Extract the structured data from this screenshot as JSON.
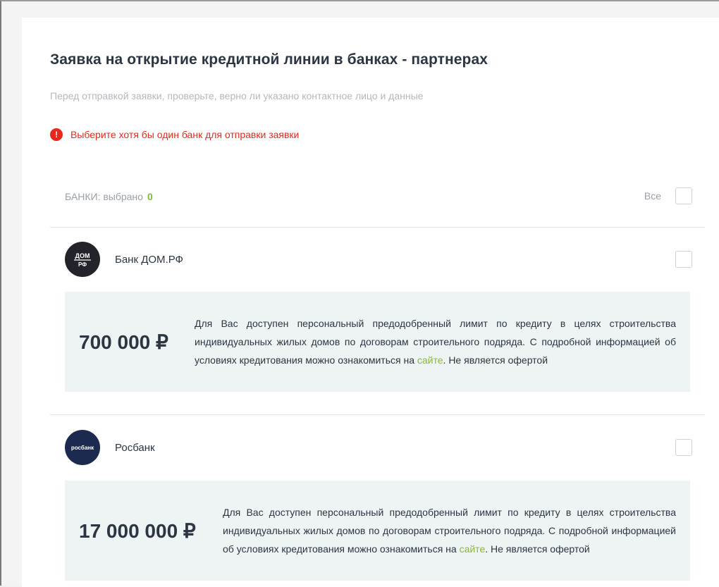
{
  "header": {
    "title": "Заявка на открытие кредитной линии в банках - партнерах",
    "subtitle": "Перед отправкой заявки, проверьте, верно ли указано контактное лицо и данные"
  },
  "error": {
    "icon": "exclamation-icon",
    "text": "Выберите хотя бы один банк для отправки заявки"
  },
  "banks_header": {
    "label": "БАНКИ: выбрано",
    "count": "0",
    "all_label": "Все"
  },
  "banks": [
    {
      "name": "Банк ДОМ.РФ",
      "logo_text": "ДОМ",
      "logo_subtext": "РФ",
      "amount": "700 000 ₽",
      "desc_before_link": "Для Вас доступен персональный предодобренный лимит по кредиту в целях строительства индивидуальных жилых домов по договорам строительного подряда. С подробной информацией об условиях кредитования можно ознакомиться на ",
      "link_text": "сайте",
      "desc_after_link": ". Не является офертой"
    },
    {
      "name": "Росбанк",
      "logo_text": "росбанк",
      "amount": "17 000 000 ₽",
      "desc_before_link": "Для Вас доступен персональный предодобренный лимит по кредиту в целях строительства индивидуальных жилых домов по договорам строительного подряда. С подробной информацией об условиях кредитования можно ознакомиться на ",
      "link_text": "сайте",
      "desc_after_link": ". Не является офертой"
    }
  ],
  "colors": {
    "error": "#e8271d",
    "accent_green": "#7dbb2c",
    "link": "#8cb83c",
    "offer_bg": "#eef3f3",
    "domrf_logo": "#23232b",
    "rosbank_logo": "#1d2a50"
  }
}
